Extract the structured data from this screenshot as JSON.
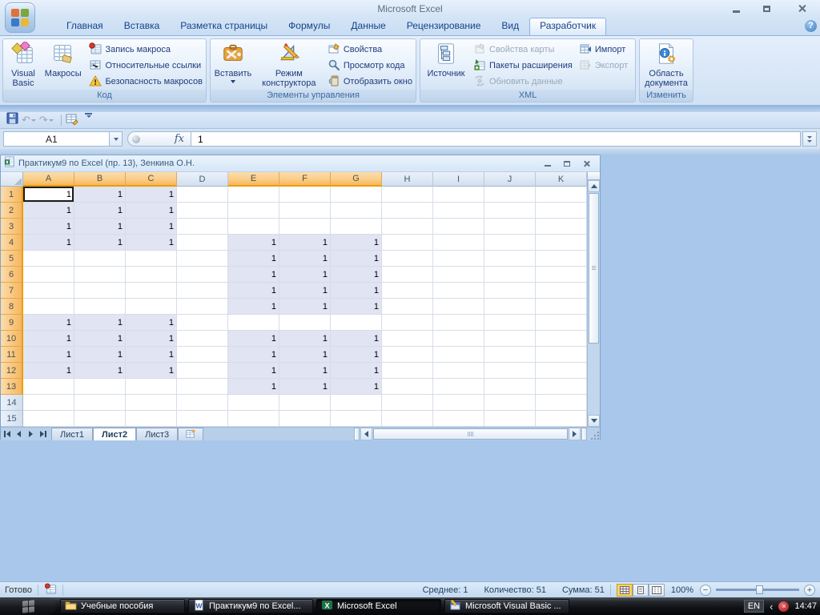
{
  "titlebar": {
    "title": "Microsoft Excel"
  },
  "ribbon_tabs": [
    {
      "label": "Главная",
      "active": false
    },
    {
      "label": "Вставка",
      "active": false
    },
    {
      "label": "Разметка страницы",
      "active": false
    },
    {
      "label": "Формулы",
      "active": false
    },
    {
      "label": "Данные",
      "active": false
    },
    {
      "label": "Рецензирование",
      "active": false
    },
    {
      "label": "Вид",
      "active": false
    },
    {
      "label": "Разработчик",
      "active": true
    }
  ],
  "ribbon": {
    "kod": {
      "label": "Код",
      "visual_basic": "Visual Basic",
      "macros": "Макросы",
      "record_macro": "Запись макроса",
      "relative_refs": "Относительные ссылки",
      "macro_security": "Безопасность макросов"
    },
    "controls": {
      "label": "Элементы управления",
      "insert": "Вставить",
      "design_mode": "Режим конструктора",
      "properties": "Свойства",
      "view_code": "Просмотр кода",
      "show_window": "Отобразить окно"
    },
    "xml": {
      "label": "XML",
      "source": "Источник",
      "map_properties": "Свойства карты",
      "expansion_packs": "Пакеты расширения",
      "refresh_data": "Обновить данные",
      "import": "Импорт",
      "export": "Экспорт"
    },
    "edit": {
      "label": "Изменить",
      "document_panel": "Область документа"
    }
  },
  "formula_bar": {
    "name_box": "A1",
    "fx_label": "fx",
    "formula": "1"
  },
  "workbook": {
    "title": "Практикум9 по Excel (пр. 13), Зенкина О.Н."
  },
  "grid": {
    "columns": [
      "A",
      "B",
      "C",
      "D",
      "E",
      "F",
      "G",
      "H",
      "I",
      "J",
      "K"
    ],
    "active_cell": "A1",
    "rows": [
      [
        "1",
        "1",
        "1",
        "",
        "",
        "",
        "",
        "",
        "",
        "",
        ""
      ],
      [
        "1",
        "1",
        "1",
        "",
        "",
        "",
        "",
        "",
        "",
        "",
        ""
      ],
      [
        "1",
        "1",
        "1",
        "",
        "",
        "",
        "",
        "",
        "",
        "",
        ""
      ],
      [
        "1",
        "1",
        "1",
        "",
        "1",
        "1",
        "1",
        "",
        "",
        "",
        ""
      ],
      [
        "",
        "",
        "",
        "",
        "1",
        "1",
        "1",
        "",
        "",
        "",
        ""
      ],
      [
        "",
        "",
        "",
        "",
        "1",
        "1",
        "1",
        "",
        "",
        "",
        ""
      ],
      [
        "",
        "",
        "",
        "",
        "1",
        "1",
        "1",
        "",
        "",
        "",
        ""
      ],
      [
        "",
        "",
        "",
        "",
        "1",
        "1",
        "1",
        "",
        "",
        "",
        ""
      ],
      [
        "1",
        "1",
        "1",
        "",
        "",
        "",
        "",
        "",
        "",
        "",
        ""
      ],
      [
        "1",
        "1",
        "1",
        "",
        "1",
        "1",
        "1",
        "",
        "",
        "",
        ""
      ],
      [
        "1",
        "1",
        "1",
        "",
        "1",
        "1",
        "1",
        "",
        "",
        "",
        ""
      ],
      [
        "1",
        "1",
        "1",
        "",
        "1",
        "1",
        "1",
        "",
        "",
        "",
        ""
      ],
      [
        "",
        "",
        "",
        "",
        "1",
        "1",
        "1",
        "",
        "",
        "",
        ""
      ],
      [
        "",
        "",
        "",
        "",
        "",
        "",
        "",
        "",
        "",
        "",
        ""
      ],
      [
        "",
        "",
        "",
        "",
        "",
        "",
        "",
        "",
        "",
        "",
        ""
      ]
    ]
  },
  "sheet_tabs": [
    {
      "label": "Лист1",
      "active": false
    },
    {
      "label": "Лист2",
      "active": true
    },
    {
      "label": "Лист3",
      "active": false
    }
  ],
  "status": {
    "ready": "Готово",
    "avg": "Среднее: 1",
    "count": "Количество: 51",
    "sum": "Сумма: 51",
    "zoom": "100%"
  },
  "taskbar": {
    "items": [
      {
        "label": "Учебные пособия",
        "icon": "folder",
        "active": false
      },
      {
        "label": "Практикум9 по Excel...",
        "icon": "word",
        "active": false
      },
      {
        "label": "Microsoft Excel",
        "icon": "excel",
        "active": true
      },
      {
        "label": "Microsoft Visual Basic ...",
        "icon": "vb",
        "active": false
      }
    ],
    "tray": {
      "lang": "EN",
      "time": "14:47"
    }
  }
}
